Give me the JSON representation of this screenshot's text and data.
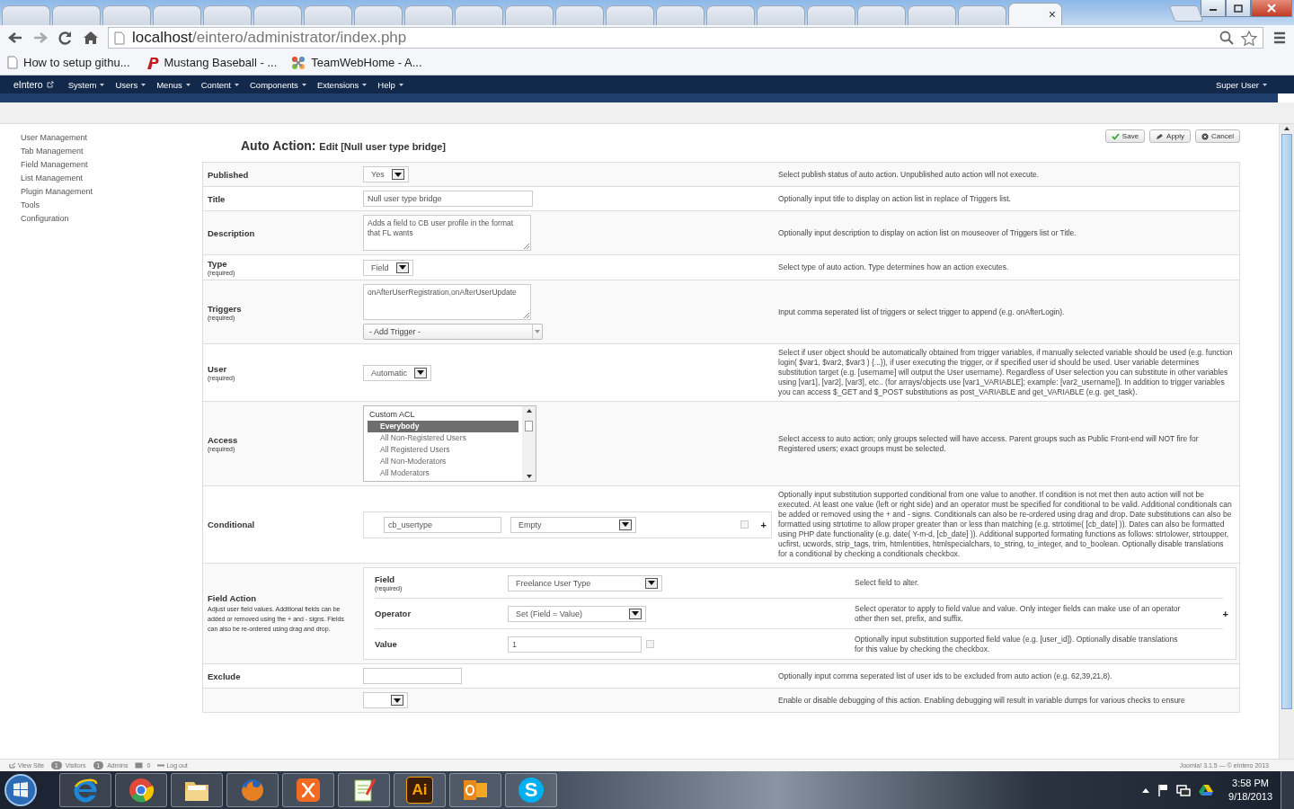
{
  "browser": {
    "tabs": [
      {
        "selected": false
      },
      {
        "selected": false
      },
      {
        "selected": false
      },
      {
        "selected": false
      },
      {
        "selected": false
      },
      {
        "selected": false
      },
      {
        "selected": false
      },
      {
        "selected": false
      },
      {
        "selected": false
      },
      {
        "selected": false
      },
      {
        "selected": false
      },
      {
        "selected": false
      },
      {
        "selected": false
      },
      {
        "selected": false
      },
      {
        "selected": false
      },
      {
        "selected": false
      },
      {
        "selected": false
      },
      {
        "selected": false
      },
      {
        "selected": false
      },
      {
        "selected": false
      },
      {
        "selected": true,
        "close": "×"
      }
    ],
    "url_host": "localhost",
    "url_path": "/eintero/administrator/index.php",
    "bookmarks": [
      {
        "label": "How to setup githu...",
        "kind": "page"
      },
      {
        "label": "Mustang Baseball - ...",
        "kind": "p"
      },
      {
        "label": "TeamWebHome - A...",
        "kind": "joomla"
      }
    ]
  },
  "admin_menu": {
    "brand": "eIntero",
    "items": [
      "System",
      "Users",
      "Menus",
      "Content",
      "Components",
      "Extensions",
      "Help"
    ],
    "user": "Super User"
  },
  "sidebar": {
    "items": [
      "User Management",
      "Tab Management",
      "Field Management",
      "List Management",
      "Plugin Management",
      "Tools",
      "Configuration"
    ]
  },
  "header": {
    "title": "Auto Action:",
    "subtitle": "Edit [Null user type bridge]"
  },
  "toolbar": [
    {
      "label": "Save",
      "kind": "save"
    },
    {
      "label": "Apply",
      "kind": "apply"
    },
    {
      "label": "Cancel",
      "kind": "cancel"
    }
  ],
  "rows": [
    {
      "kind": "select",
      "label": "Published",
      "value": "Yes",
      "help": "Select publish status of auto action. Unpublished auto action will not execute."
    },
    {
      "kind": "text",
      "label": "Title",
      "value": "Null user type bridge",
      "help": "Optionally input title to display on action list in replace of Triggers list."
    },
    {
      "kind": "textarea",
      "label": "Description",
      "value": "Adds a field to CB user profile in the format that FL wants",
      "help": "Optionally input description to display on action list on mouseover of Triggers list or Title."
    },
    {
      "kind": "select",
      "label": "Type",
      "required": "(required)",
      "value": "Field",
      "help": "Select type of auto action. Type determines how an action executes."
    },
    {
      "kind": "triggers",
      "label": "Triggers",
      "required": "(required)",
      "value": "onAfterUserRegistration,onAfterUserUpdate",
      "add": "- Add Trigger -",
      "help": "Input comma seperated list of triggers or select trigger to append (e.g. onAfterLogin)."
    },
    {
      "kind": "select",
      "label": "User",
      "required": "(required)",
      "value": "Automatic",
      "help": "Select if user object should be automatically obtained from trigger variables, if manually selected variable should be used (e.g. function login( $var1, $var2, $var3 ) {...}), if user executing the trigger, or if specified user id should be used. User variable determines substitution target (e.g. [username] will output the User username). Regardless of User selection you can substitute in other variables using [var1], [var2], [var3], etc.. (for arrays/objects use [var1_VARIABLE]; example: [var2_username]). In addition to trigger variables you can access $_GET and $_POST substitutions as post_VARIABLE and get_VARIABLE (e.g. get_task)."
    },
    {
      "kind": "listbox",
      "label": "Access",
      "required": "(required)",
      "group": "Custom ACL",
      "options": [
        {
          "label": "Everybody",
          "selected": true
        },
        {
          "label": "All Non-Registered Users",
          "selected": false
        },
        {
          "label": "All Registered Users",
          "selected": false
        },
        {
          "label": "All Non-Moderators",
          "selected": false
        },
        {
          "label": "All Moderators",
          "selected": false
        }
      ],
      "help": "Select access to auto action; only groups selected will have access. Parent groups such as Public Front-end will NOT fire for Registered users; exact groups must be selected."
    },
    {
      "kind": "conditional",
      "label": "Conditional",
      "field": "cb_usertype",
      "operator": "Empty",
      "checked": false,
      "add_sign": "+",
      "help": "Optionally input substitution supported conditional from one value to another. If condition is not met then auto action will not be executed. At least one value (left or right side) and an operator must be specified for conditional to be valid. Additional conditionals can be added or removed using the + and - signs. Conditionals can also be re-ordered using drag and drop. Date substitutions can also be formatted using strtotime to allow proper greater than or less than matching (e.g. strtotime( [cb_date] )). Dates can also be formatted using PHP date functionality (e.g. date( Y-m-d, [cb_date] )). Additional supported formating functions as follows: strtolower, strtoupper, ucfirst, ucwords, strip_tags, trim, htmlentities, htmlspecialchars, to_string, to_integer, and to_boolean. Optionally disable translations for a conditional by checking a conditionals checkbox."
    },
    {
      "kind": "field_action",
      "label": "Field Action",
      "note": "Adjust user field values. Additional fields can be added or removed using the + and - signs. Fields can also be re-ordered using drag and drop.",
      "add_sign": "+",
      "subrows": [
        {
          "kind": "select",
          "label": "Field",
          "required": "(required)",
          "value": "Freelance User Type",
          "help": "Select field to alter."
        },
        {
          "kind": "select",
          "label": "Operator",
          "value": "Set (Field = Value)",
          "help": "Select operator to apply to field value and value. Only integer fields can make use of an operator other then set, prefix, and suffix."
        },
        {
          "kind": "text_check",
          "label": "Value",
          "value": "1",
          "checked": false,
          "help": "Optionally input substitution supported field value (e.g. [user_id]). Optionally disable translations for this value by checking the checkbox."
        }
      ]
    },
    {
      "kind": "text",
      "label": "Exclude",
      "help": "Optionally input comma seperated list of user ids to be excluded from auto action (e.g. 62,39,21,8)."
    },
    {
      "kind": "select",
      "help": "Enable or disable debugging of this action. Enabling debugging will result in variable dumps for various checks to ensure"
    }
  ],
  "footer": {
    "view_site": "View Site",
    "visitors_count": "1",
    "visitors": "Visitors",
    "admins_count": "1",
    "admins": "Admins",
    "messages": "0",
    "logout": "Log out",
    "version": "Joomla! 3.1.5 — © eIntero 2013"
  },
  "taskbar": {
    "apps": [
      {
        "kind": "ie"
      },
      {
        "kind": "chrome"
      },
      {
        "kind": "folder"
      },
      {
        "kind": "firefox"
      },
      {
        "kind": "xampp"
      },
      {
        "kind": "notepad"
      },
      {
        "kind": "illustrator",
        "label": "Ai"
      },
      {
        "kind": "outlook"
      },
      {
        "kind": "skype",
        "label": "S"
      }
    ],
    "time": "3:58 PM",
    "date": "9/18/2013"
  }
}
